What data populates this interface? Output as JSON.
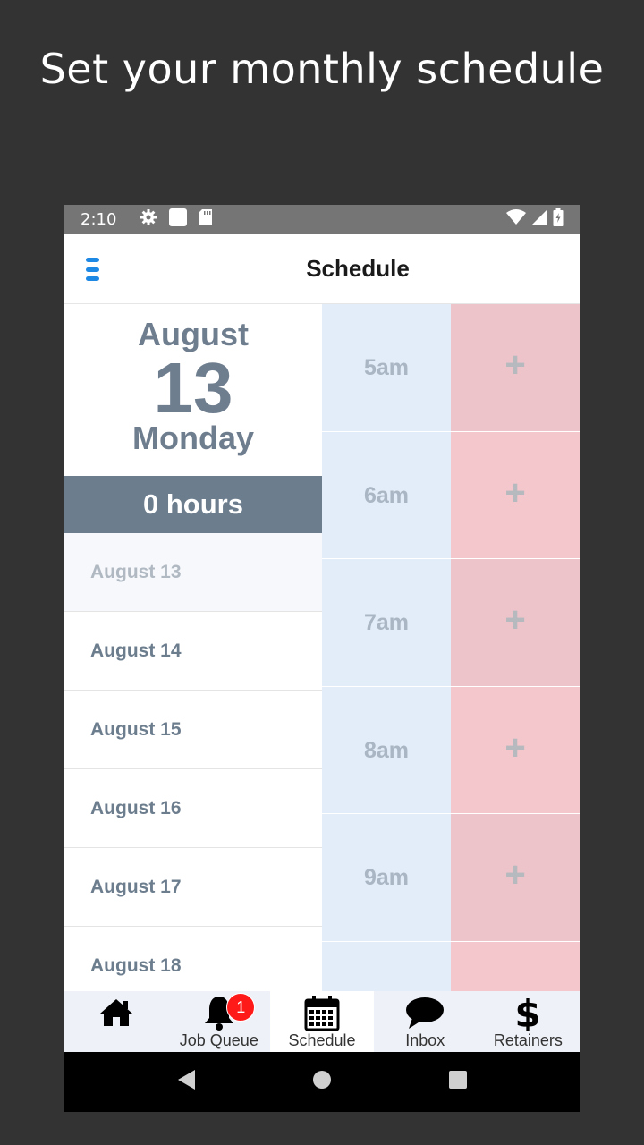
{
  "promo": {
    "headline": "Set your monthly schedule"
  },
  "status_bar": {
    "time": "2:10",
    "icons": [
      "gear-icon",
      "square-icon",
      "sd-card-icon",
      "wifi-icon",
      "signal-icon",
      "battery-icon"
    ]
  },
  "app_bar": {
    "title": "Schedule",
    "menu_icon": "hamburger-menu-icon",
    "accent": "#1e88e5"
  },
  "selected_date": {
    "month": "August",
    "day": "13",
    "weekday": "Monday",
    "hours": "0 hours"
  },
  "date_list": [
    {
      "label": "August 13",
      "selected": true
    },
    {
      "label": "August 14",
      "selected": false
    },
    {
      "label": "August 15",
      "selected": false
    },
    {
      "label": "August 16",
      "selected": false
    },
    {
      "label": "August 17",
      "selected": false
    },
    {
      "label": "August 18",
      "selected": false
    }
  ],
  "slots": [
    {
      "time": "5am",
      "add": "+"
    },
    {
      "time": "6am",
      "add": "+"
    },
    {
      "time": "7am",
      "add": "+"
    },
    {
      "time": "8am",
      "add": "+"
    },
    {
      "time": "9am",
      "add": "+"
    },
    {
      "time": "",
      "add": ""
    }
  ],
  "tab_bar": {
    "tabs": [
      {
        "label": "",
        "icon": "home-icon"
      },
      {
        "label": "Job Queue",
        "icon": "bell-icon",
        "badge": "1"
      },
      {
        "label": "Schedule",
        "icon": "calendar-icon",
        "active": true
      },
      {
        "label": "Inbox",
        "icon": "chat-bubble-icon"
      },
      {
        "label": "Retainers",
        "icon": "dollar-icon"
      }
    ]
  },
  "colors": {
    "background": "#333333",
    "badge": "#ff1a1a",
    "slot_time_bg": "#e3edf9",
    "slot_add_bg": "#f3c7cb",
    "hours_bar": "#6c7d8e"
  }
}
